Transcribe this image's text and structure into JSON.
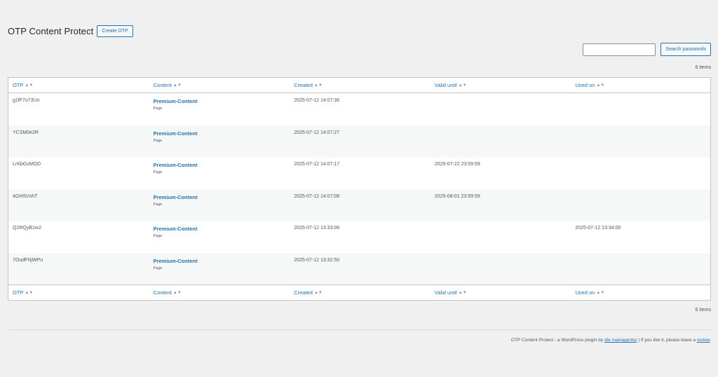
{
  "header": {
    "title": "OTP Content Protect",
    "create_button": "Create OTP"
  },
  "search": {
    "value": "",
    "button_label": "Search passwords"
  },
  "items_count": "6 items",
  "table": {
    "columns": [
      "OTP",
      "Content",
      "Created",
      "Valid until",
      "Used on"
    ],
    "rows": [
      {
        "otp": "g1fF7o73Un",
        "content": "Premium-Content",
        "type": "Page",
        "created": "2025-07-12 14:07:36",
        "valid_until": "",
        "used_on": ""
      },
      {
        "otp": "YCSM0e2R",
        "content": "Premium-Content",
        "type": "Page",
        "created": "2025-07-12 14:07:27",
        "valid_until": "",
        "used_on": ""
      },
      {
        "otp": "LrKbGoMDD",
        "content": "Premium-Content",
        "type": "Page",
        "created": "2025-07-12 14:07:17",
        "valid_until": "2025-07-22 23:59:59",
        "used_on": ""
      },
      {
        "otp": "4GHSVshT",
        "content": "Premium-Content",
        "type": "Page",
        "created": "2025-07-12 14:07:08",
        "valid_until": "2025-08-01 23:59:59",
        "used_on": ""
      },
      {
        "otp": "Q2RQyB1w2",
        "content": "Premium-Content",
        "type": "Page",
        "created": "2025-07-12 13:33:06",
        "valid_until": "",
        "used_on": "2025-07-12 13:34:00"
      },
      {
        "otp": "7OudFNjWPu",
        "content": "Premium-Content",
        "type": "Page",
        "created": "2025-07-12 13:32:50",
        "valid_until": "",
        "used_on": ""
      }
    ]
  },
  "footer": {
    "text_before": "OTP Content Protect - a WordPress plugin by ",
    "author_link": "die mainagentur",
    "text_middle": " | If you like it, please leave a ",
    "review_link": "review",
    "text_after": "."
  },
  "colors": {
    "accent": "#2271b1",
    "background": "#f0f0f1"
  },
  "icons": {
    "sort": "sort-arrows-icon"
  }
}
